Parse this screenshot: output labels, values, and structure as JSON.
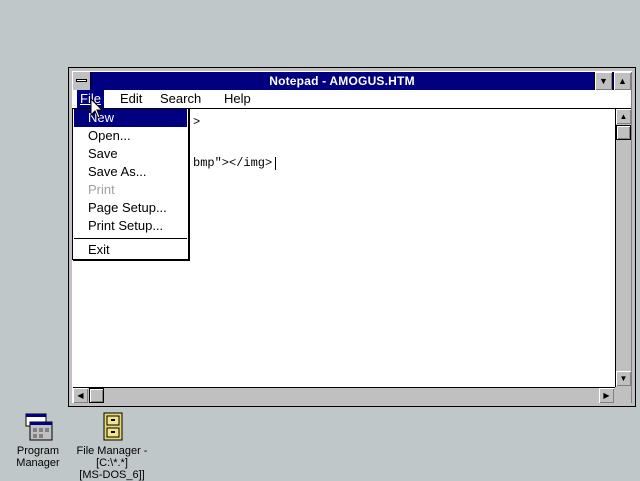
{
  "window": {
    "title": "Notepad - AMOGUS.HTM",
    "minimize_glyph": "▼",
    "maximize_glyph": "▲"
  },
  "menubar": {
    "file": "File",
    "edit": "Edit",
    "search": "Search",
    "help": "Help"
  },
  "editor": {
    "line1": ">",
    "line2": "bmp\"></img>"
  },
  "file_menu": {
    "new": "New",
    "open": "Open...",
    "save": "Save",
    "save_as": "Save As...",
    "print": "Print",
    "page_setup": "Page Setup...",
    "print_setup": "Print Setup...",
    "exit": "Exit"
  },
  "scrollbar": {
    "up": "▲",
    "down": "▼",
    "left": "◀",
    "right": "▶"
  },
  "desktop": {
    "program_manager": "Program Manager",
    "file_manager_line1": "File Manager -",
    "file_manager_line2": "[C:\\*.*]",
    "file_manager_line3": "[MS-DOS_6]]"
  },
  "colors": {
    "desktop": "#c0c7c8",
    "titlebar": "#000080",
    "selection": "#000080"
  }
}
